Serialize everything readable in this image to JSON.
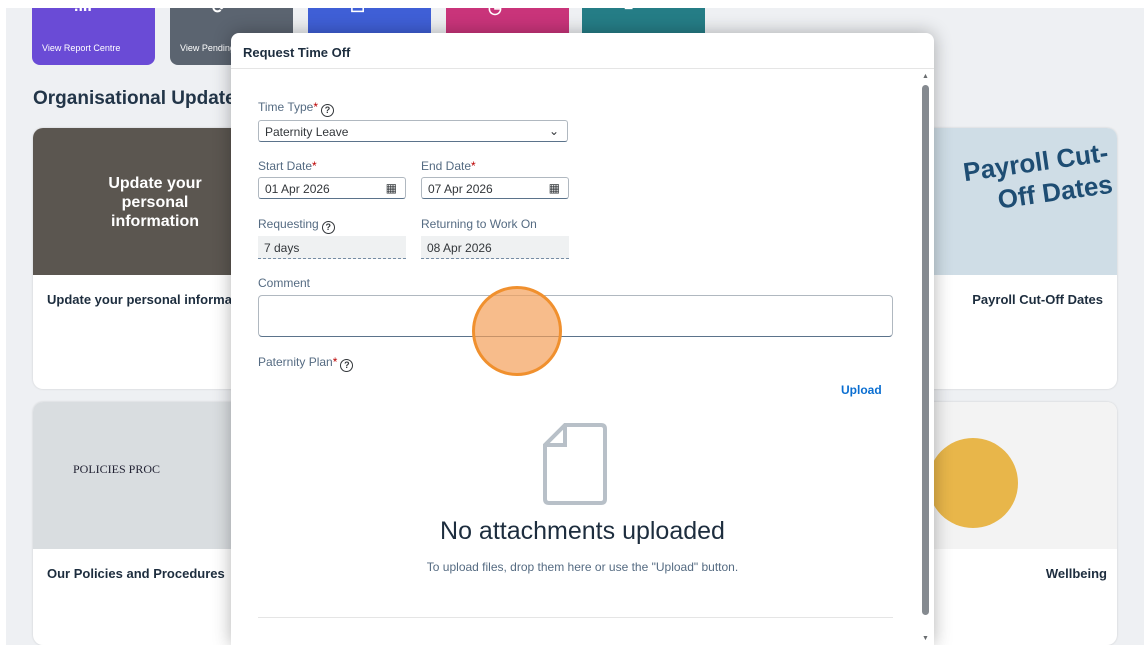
{
  "tiles": [
    {
      "label": "View Report Centre",
      "color": "#6a4bd6",
      "icon": "chart-icon"
    },
    {
      "label": "View Pending Workflows",
      "color": "#5b6470",
      "icon": "refresh-icon"
    },
    {
      "label": "",
      "color": "#3f5fd6",
      "icon": "document-icon"
    },
    {
      "label": "",
      "color": "#c9347a",
      "icon": "clock-icon"
    },
    {
      "label": "",
      "color": "#257d86",
      "icon": "list-icon"
    }
  ],
  "section": {
    "title": "Organisational Updates"
  },
  "cards": [
    {
      "title": "Update your personal information",
      "image_text": "Update your personal information"
    },
    {
      "title": "Payroll Cut-Off Dates",
      "image_text": "Payroll Cut-Off Dates"
    },
    {
      "title": "Our Policies and Procedures",
      "image_text": "POLICIES PROC"
    },
    {
      "title": "Wellbeing",
      "image_text": ""
    }
  ],
  "dialog": {
    "title": "Request Time Off",
    "time_type": {
      "label": "Time Type",
      "required": "*",
      "value": "Paternity Leave",
      "icon": "chevron-down-icon"
    },
    "start_date": {
      "label": "Start Date",
      "required": "*",
      "value": "01 Apr 2026",
      "icon": "calendar-icon"
    },
    "end_date": {
      "label": "End Date",
      "required": "*",
      "value": "07 Apr 2026",
      "icon": "calendar-icon"
    },
    "requesting": {
      "label": "Requesting",
      "value": "7 days"
    },
    "returning": {
      "label": "Returning to Work On",
      "value": "08 Apr 2026"
    },
    "comment": {
      "label": "Comment",
      "value": ""
    },
    "plan": {
      "label": "Paternity Plan",
      "required": "*"
    },
    "upload_label": "Upload",
    "empty_title": "No attachments uploaded",
    "empty_subtitle": "To upload files, drop them here or use the \"Upload\" button."
  },
  "colors": {
    "accent": "#0a6ed1",
    "required": "#bb0000",
    "click_marker": "#f0902e"
  }
}
